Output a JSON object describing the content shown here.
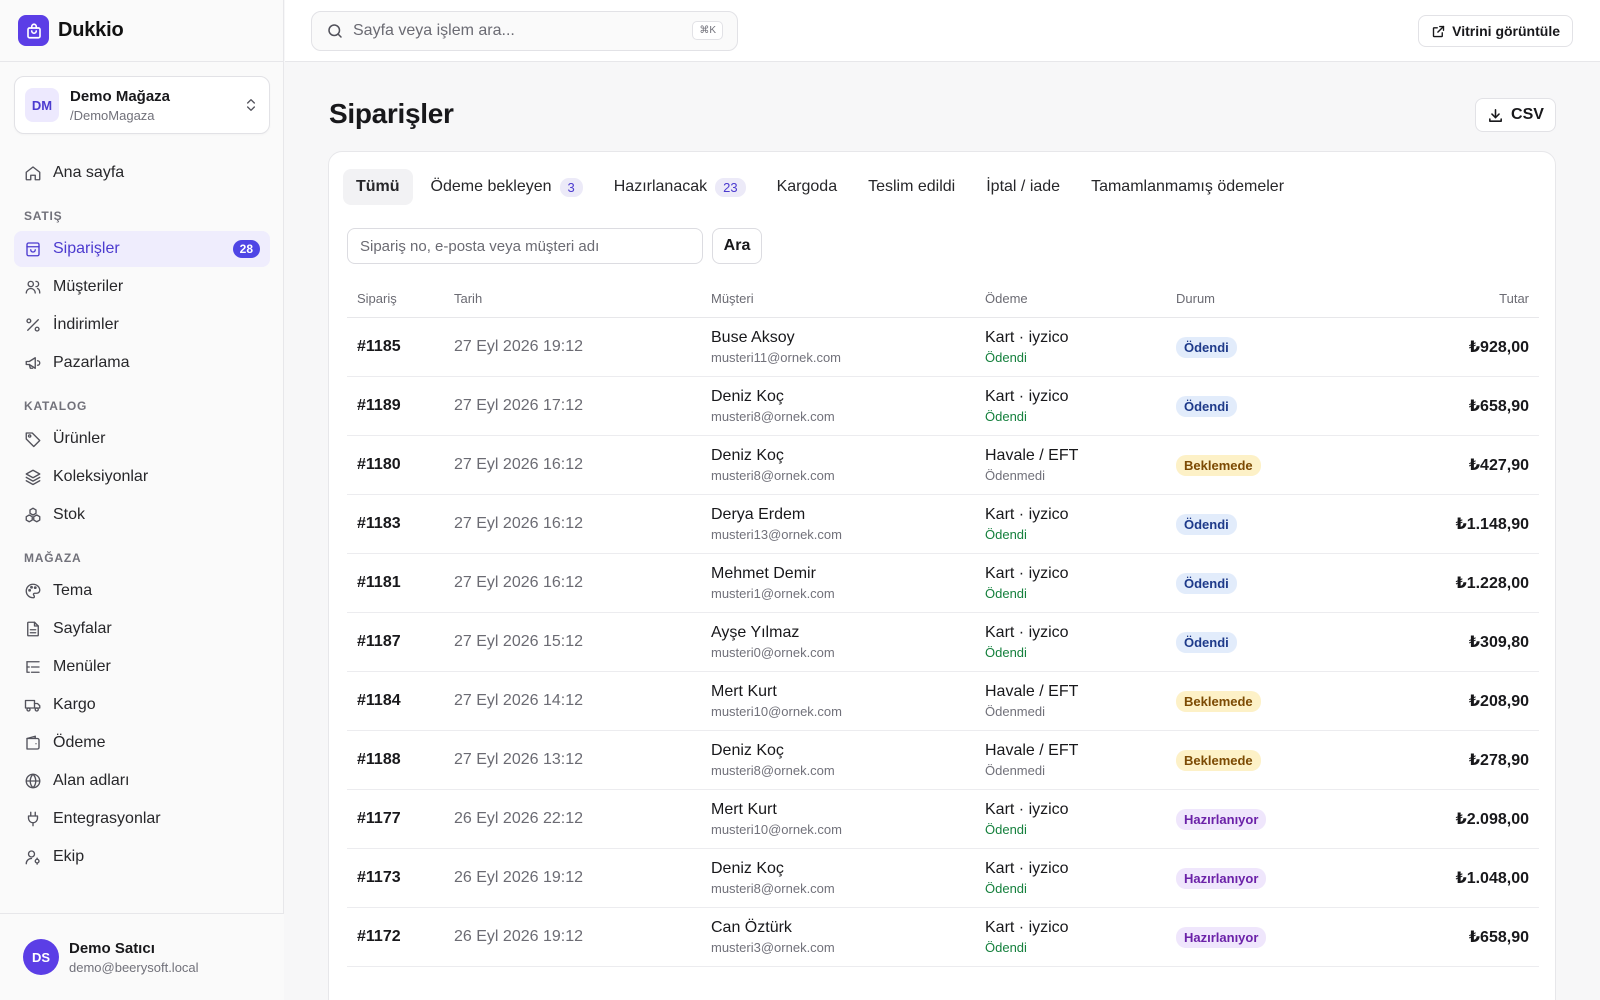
{
  "app": {
    "name": "Dukkio"
  },
  "store": {
    "initials": "DM",
    "name": "Demo Mağaza",
    "handle": "/DemoMagaza"
  },
  "nav": {
    "home": "Ana sayfa",
    "sections": [
      {
        "title": "SATIŞ",
        "items": [
          {
            "label": "Siparişler",
            "icon": "shopping-bag-icon",
            "badge": "28",
            "active": true
          },
          {
            "label": "Müşteriler",
            "icon": "users-icon"
          },
          {
            "label": "İndirimler",
            "icon": "percent-icon"
          },
          {
            "label": "Pazarlama",
            "icon": "megaphone-icon"
          }
        ]
      },
      {
        "title": "KATALOG",
        "items": [
          {
            "label": "Ürünler",
            "icon": "tag-icon"
          },
          {
            "label": "Koleksiyonlar",
            "icon": "layers-icon"
          },
          {
            "label": "Stok",
            "icon": "boxes-icon"
          }
        ]
      },
      {
        "title": "MAĞAZA",
        "items": [
          {
            "label": "Tema",
            "icon": "palette-icon"
          },
          {
            "label": "Sayfalar",
            "icon": "file-text-icon"
          },
          {
            "label": "Menüler",
            "icon": "list-tree-icon"
          },
          {
            "label": "Kargo",
            "icon": "truck-icon"
          },
          {
            "label": "Ödeme",
            "icon": "wallet-icon"
          },
          {
            "label": "Alan adları",
            "icon": "globe-icon"
          },
          {
            "label": "Entegrasyonlar",
            "icon": "plug-icon"
          },
          {
            "label": "Ekip",
            "icon": "user-cog-icon"
          }
        ]
      }
    ]
  },
  "user": {
    "initials": "DS",
    "name": "Demo Satıcı",
    "email": "demo@beerysoft.local"
  },
  "topbar": {
    "search_placeholder": "Sayfa veya işlem ara...",
    "shortcut": "⌘K",
    "storefront_label": "Vitrini görüntüle"
  },
  "page": {
    "title": "Siparişler",
    "csv_label": "CSV"
  },
  "tabs": [
    {
      "label": "Tümü",
      "active": true
    },
    {
      "label": "Ödeme bekleyen",
      "count": "3"
    },
    {
      "label": "Hazırlanacak",
      "count": "23"
    },
    {
      "label": "Kargoda"
    },
    {
      "label": "Teslim edildi"
    },
    {
      "label": "İptal / iade"
    },
    {
      "label": "Tamamlanmamış ödemeler"
    }
  ],
  "filter": {
    "placeholder": "Sipariş no, e-posta veya müşteri adı",
    "search_label": "Ara"
  },
  "table": {
    "headers": {
      "order": "Sipariş",
      "date": "Tarih",
      "customer": "Müşteri",
      "payment": "Ödeme",
      "status": "Durum",
      "amount": "Tutar"
    },
    "rows": [
      {
        "order": "#1185",
        "date": "27 Eyl 2026 19:12",
        "name": "Buse Aksoy",
        "email": "musteri11@ornek.com",
        "method": "Kart · iyzico",
        "pay_status": "Ödendi",
        "pay_kind": "paid",
        "status": "Ödendi",
        "status_kind": "paid",
        "amount": "₺928,00"
      },
      {
        "order": "#1189",
        "date": "27 Eyl 2026 17:12",
        "name": "Deniz Koç",
        "email": "musteri8@ornek.com",
        "method": "Kart · iyzico",
        "pay_status": "Ödendi",
        "pay_kind": "paid",
        "status": "Ödendi",
        "status_kind": "paid",
        "amount": "₺658,90"
      },
      {
        "order": "#1180",
        "date": "27 Eyl 2026 16:12",
        "name": "Deniz Koç",
        "email": "musteri8@ornek.com",
        "method": "Havale / EFT",
        "pay_status": "Ödenmedi",
        "pay_kind": "unpaid",
        "status": "Beklemede",
        "status_kind": "pending",
        "amount": "₺427,90"
      },
      {
        "order": "#1183",
        "date": "27 Eyl 2026 16:12",
        "name": "Derya Erdem",
        "email": "musteri13@ornek.com",
        "method": "Kart · iyzico",
        "pay_status": "Ödendi",
        "pay_kind": "paid",
        "status": "Ödendi",
        "status_kind": "paid",
        "amount": "₺1.148,90"
      },
      {
        "order": "#1181",
        "date": "27 Eyl 2026 16:12",
        "name": "Mehmet Demir",
        "email": "musteri1@ornek.com",
        "method": "Kart · iyzico",
        "pay_status": "Ödendi",
        "pay_kind": "paid",
        "status": "Ödendi",
        "status_kind": "paid",
        "amount": "₺1.228,00"
      },
      {
        "order": "#1187",
        "date": "27 Eyl 2026 15:12",
        "name": "Ayşe Yılmaz",
        "email": "musteri0@ornek.com",
        "method": "Kart · iyzico",
        "pay_status": "Ödendi",
        "pay_kind": "paid",
        "status": "Ödendi",
        "status_kind": "paid",
        "amount": "₺309,80"
      },
      {
        "order": "#1184",
        "date": "27 Eyl 2026 14:12",
        "name": "Mert Kurt",
        "email": "musteri10@ornek.com",
        "method": "Havale / EFT",
        "pay_status": "Ödenmedi",
        "pay_kind": "unpaid",
        "status": "Beklemede",
        "status_kind": "pending",
        "amount": "₺208,90"
      },
      {
        "order": "#1188",
        "date": "27 Eyl 2026 13:12",
        "name": "Deniz Koç",
        "email": "musteri8@ornek.com",
        "method": "Havale / EFT",
        "pay_status": "Ödenmedi",
        "pay_kind": "unpaid",
        "status": "Beklemede",
        "status_kind": "pending",
        "amount": "₺278,90"
      },
      {
        "order": "#1177",
        "date": "26 Eyl 2026 22:12",
        "name": "Mert Kurt",
        "email": "musteri10@ornek.com",
        "method": "Kart · iyzico",
        "pay_status": "Ödendi",
        "pay_kind": "paid",
        "status": "Hazırlanıyor",
        "status_kind": "preparing",
        "amount": "₺2.098,00"
      },
      {
        "order": "#1173",
        "date": "26 Eyl 2026 19:12",
        "name": "Deniz Koç",
        "email": "musteri8@ornek.com",
        "method": "Kart · iyzico",
        "pay_status": "Ödendi",
        "pay_kind": "paid",
        "status": "Hazırlanıyor",
        "status_kind": "preparing",
        "amount": "₺1.048,00"
      },
      {
        "order": "#1172",
        "date": "26 Eyl 2026 19:12",
        "name": "Can Öztürk",
        "email": "musteri3@ornek.com",
        "method": "Kart · iyzico",
        "pay_status": "Ödendi",
        "pay_kind": "paid",
        "status": "Hazırlanıyor",
        "status_kind": "preparing",
        "amount": "₺658,90"
      }
    ]
  }
}
